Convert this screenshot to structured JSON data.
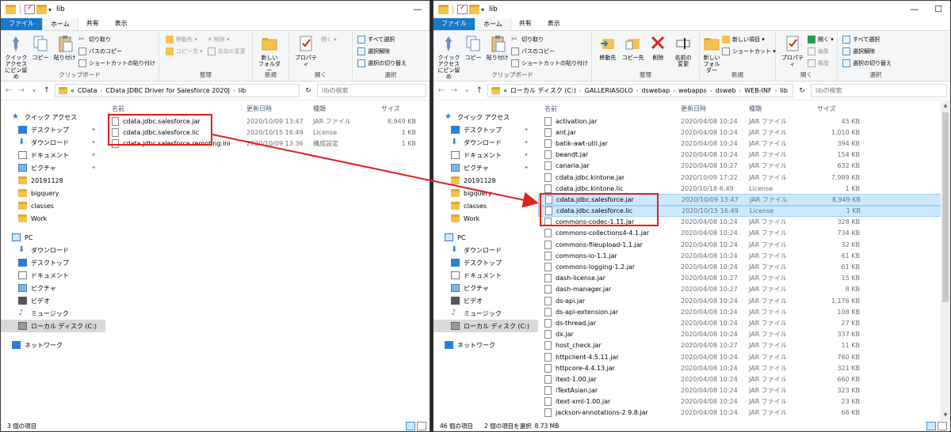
{
  "left": {
    "title": "lib",
    "tabs": [
      "ファイル",
      "ホーム",
      "共有",
      "表示"
    ],
    "ribbon": {
      "clipboard": {
        "pin": "クイック アクセス\nにピン留め",
        "copy": "コピー",
        "paste": "貼り付け",
        "cut": "切り取り",
        "copy_path": "パスのコピー",
        "paste_shortcut": "ショートカットの貼り付け",
        "group": "クリップボード"
      },
      "organize": {
        "move": "移動先 ▾",
        "delete": "✕ 削除 ▾",
        "copy_to": "コピー先 ▾",
        "rename": "名前の変更",
        "group": "整理"
      },
      "new": {
        "folder": "新しい\nフォルダー",
        "group": "新規"
      },
      "open": {
        "properties": "プロパティ",
        "open": "開く ▾",
        "group": "開く"
      },
      "select": {
        "all": "すべて選択",
        "none": "選択解除",
        "invert": "選択の切り替え",
        "group": "選択"
      }
    },
    "path": [
      "«",
      "CData",
      "CData JDBC Driver for Salesforce 2020J",
      "lib"
    ],
    "search_placeholder": "libの検索",
    "columns": {
      "name": "名前",
      "date": "更新日時",
      "type": "種類",
      "size": "サイズ"
    },
    "files": [
      {
        "name": "cdata.jdbc.salesforce.jar",
        "date": "2020/10/09 13:47",
        "type": "JAR ファイル",
        "size": "8,949 KB"
      },
      {
        "name": "cdata.jdbc.salesforce.lic",
        "date": "2020/10/15 16:49",
        "type": "License",
        "size": "1 KB"
      },
      {
        "name": "cdata.jdbc.salesforce.remoting.ini",
        "date": "2020/10/09 13:36",
        "type": "構成設定",
        "size": "1 KB"
      }
    ],
    "status": "3 個の項目"
  },
  "right": {
    "title": "lib",
    "tabs": [
      "ファイル",
      "ホーム",
      "共有",
      "表示"
    ],
    "ribbon": {
      "clipboard": {
        "pin": "クイック アクセス\nにピン留め",
        "copy": "コピー",
        "paste": "貼り付け",
        "cut": "切り取り",
        "copy_path": "パスのコピー",
        "paste_shortcut": "ショートカットの貼り付け",
        "group": "クリップボード"
      },
      "organize": {
        "move": "移動先",
        "copy_to": "コピー先",
        "delete": "削除",
        "rename": "名前の\n変更",
        "group": "整理"
      },
      "new": {
        "item": "新しい項目 ▾",
        "shortcut": "ショートカット ▾",
        "folder": "新しい\nフォルダー",
        "group": "新規"
      },
      "open": {
        "properties": "プロパティ",
        "open": "開く ▾",
        "edit": "編集",
        "history": "履歴",
        "group": "開く"
      },
      "select": {
        "all": "すべて選択",
        "none": "選択解除",
        "invert": "選択の切り替え",
        "group": "選択"
      }
    },
    "path": [
      "«",
      "ローカル ディスク (C:)",
      "GALLERIASOLO",
      "dswebap",
      "webapps",
      "dsweb",
      "WEB-INF",
      "lib"
    ],
    "search_placeholder": "libの検索",
    "columns": {
      "name": "名前",
      "date": "更新日時",
      "type": "種類",
      "size": "サイズ"
    },
    "files": [
      {
        "name": "activation.jar",
        "date": "2020/04/08 10:24",
        "type": "JAR ファイル",
        "size": "45 KB"
      },
      {
        "name": "ant.jar",
        "date": "2020/04/08 10:24",
        "type": "JAR ファイル",
        "size": "1,010 KB"
      },
      {
        "name": "batik-awt-util.jar",
        "date": "2020/04/08 10:24",
        "type": "JAR ファイル",
        "size": "394 KB"
      },
      {
        "name": "beandt.jar",
        "date": "2020/04/08 10:24",
        "type": "JAR ファイル",
        "size": "154 KB"
      },
      {
        "name": "canaria.jar",
        "date": "2020/04/08 10:27",
        "type": "JAR ファイル",
        "size": "632 KB"
      },
      {
        "name": "cdata.jdbc.kintone.jar",
        "date": "2020/10/09 17:22",
        "type": "JAR ファイル",
        "size": "7,989 KB"
      },
      {
        "name": "cdata.jdbc.kintone.lic",
        "date": "2020/10/18 6:49",
        "type": "License",
        "size": "1 KB"
      },
      {
        "name": "cdata.jdbc.salesforce.jar",
        "date": "2020/10/09 13:47",
        "type": "JAR ファイル",
        "size": "8,949 KB",
        "selected": true
      },
      {
        "name": "cdata.jdbc.salesforce.lic",
        "date": "2020/10/15 16:49",
        "type": "License",
        "size": "1 KB",
        "selected": true
      },
      {
        "name": "commons-codec-1.11.jar",
        "date": "2020/04/08 10:24",
        "type": "JAR ファイル",
        "size": "328 KB"
      },
      {
        "name": "commons-collections4-4.1.jar",
        "date": "2020/04/08 10:24",
        "type": "JAR ファイル",
        "size": "734 KB"
      },
      {
        "name": "commons-fileupload-1.1.jar",
        "date": "2020/04/08 10:24",
        "type": "JAR ファイル",
        "size": "32 KB"
      },
      {
        "name": "commons-io-1.1.jar",
        "date": "2020/04/08 10:24",
        "type": "JAR ファイル",
        "size": "61 KB"
      },
      {
        "name": "commons-logging-1.2.jar",
        "date": "2020/04/08 10:24",
        "type": "JAR ファイル",
        "size": "61 KB"
      },
      {
        "name": "dash-license.jar",
        "date": "2020/04/08 10:27",
        "type": "JAR ファイル",
        "size": "15 KB"
      },
      {
        "name": "dash-manager.jar",
        "date": "2020/04/08 10:27",
        "type": "JAR ファイル",
        "size": "8 KB"
      },
      {
        "name": "ds-api.jar",
        "date": "2020/04/08 10:24",
        "type": "JAR ファイル",
        "size": "1,176 KB"
      },
      {
        "name": "ds-api-extension.jar",
        "date": "2020/04/08 10:24",
        "type": "JAR ファイル",
        "size": "108 KB"
      },
      {
        "name": "ds-thread.jar",
        "date": "2020/04/08 10:24",
        "type": "JAR ファイル",
        "size": "27 KB"
      },
      {
        "name": "dx.jar",
        "date": "2020/04/08 10:24",
        "type": "JAR ファイル",
        "size": "337 KB"
      },
      {
        "name": "host_check.jar",
        "date": "2020/04/08 10:27",
        "type": "JAR ファイル",
        "size": "11 KB"
      },
      {
        "name": "httpclient-4.5.11.jar",
        "date": "2020/04/08 10:24",
        "type": "JAR ファイル",
        "size": "760 KB"
      },
      {
        "name": "httpcore-4.4.13.jar",
        "date": "2020/04/08 10:24",
        "type": "JAR ファイル",
        "size": "321 KB"
      },
      {
        "name": "itext-1.00.jar",
        "date": "2020/04/08 10:24",
        "type": "JAR ファイル",
        "size": "660 KB"
      },
      {
        "name": "iTextAsian.jar",
        "date": "2020/04/08 10:24",
        "type": "JAR ファイル",
        "size": "323 KB"
      },
      {
        "name": "itext-xml-1.00.jar",
        "date": "2020/04/08 10:24",
        "type": "JAR ファイル",
        "size": "23 KB"
      },
      {
        "name": "jackson-annotations-2.9.8.jar",
        "date": "2020/04/08 10:24",
        "type": "JAR ファイル",
        "size": "66 KB"
      }
    ],
    "status": "46 個の項目",
    "status_sel": "2 個の項目を選択",
    "status_size": "8.73 MB"
  },
  "navpane": {
    "quick": "クイック アクセス",
    "quick_items": [
      "デスクトップ",
      "ダウンロード",
      "ドキュメント",
      "ピクチャ",
      "20191128",
      "bigquery",
      "classes",
      "Work"
    ],
    "pc": "PC",
    "pc_items": [
      "ダウンロード",
      "デスクトップ",
      "ドキュメント",
      "ピクチャ",
      "ビデオ",
      "ミュージック",
      "ローカル ディスク (C:)"
    ],
    "network": "ネットワーク"
  },
  "colors": {
    "file_tab": "#1979ca",
    "selection": "#cce8ff",
    "highlight": "#e0201a",
    "folder": "#f3c34d"
  }
}
